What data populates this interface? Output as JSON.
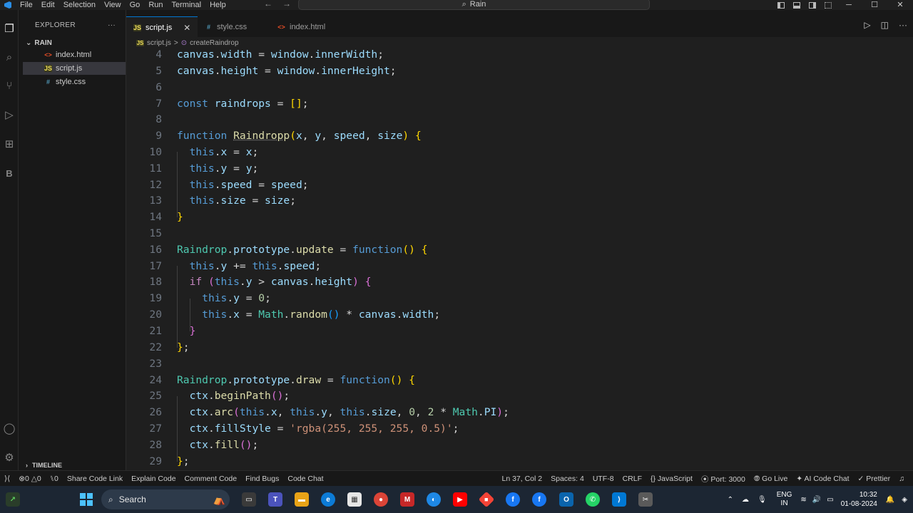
{
  "titlebar": {
    "menu": [
      "File",
      "Edit",
      "Selection",
      "View",
      "Go",
      "Run",
      "Terminal",
      "Help"
    ],
    "search": "Rain",
    "back_icon": "arrow-left-icon",
    "forward_icon": "arrow-right-icon"
  },
  "sidebar": {
    "title": "EXPLORER",
    "more": "···",
    "folder": "RAIN",
    "files": [
      {
        "name": "index.html",
        "icon": "html-file-icon",
        "badge": "<>"
      },
      {
        "name": "script.js",
        "icon": "js-file-icon",
        "badge": "JS"
      },
      {
        "name": "style.css",
        "icon": "css-file-icon",
        "badge": "#"
      }
    ],
    "timeline": "TIMELINE"
  },
  "tabs": [
    {
      "label": "script.js",
      "badge": "JS",
      "active": true
    },
    {
      "label": "style.css",
      "badge": "#",
      "active": false
    },
    {
      "label": "index.html",
      "badge": "<>",
      "active": false
    }
  ],
  "breadcrumb": {
    "file": "script.js",
    "separator": ">",
    "symbol": "createRaindrop"
  },
  "editor": {
    "line_numbers": [
      "4",
      "5",
      "6",
      "7",
      "8",
      "9",
      "10",
      "11",
      "12",
      "13",
      "14",
      "15",
      "16",
      "17",
      "18",
      "19",
      "20",
      "21",
      "22",
      "23",
      "24",
      "25",
      "26",
      "27",
      "28",
      "29"
    ]
  },
  "status": {
    "errors": "0",
    "warnings": "0",
    "ports": "0",
    "share": "Share Code Link",
    "explain": "Explain Code",
    "comment": "Comment Code",
    "bugs": "Find Bugs",
    "chat": "Code Chat",
    "position": "Ln 37, Col 2",
    "spaces": "Spaces: 4",
    "encoding": "UTF-8",
    "eol": "CRLF",
    "language": "JavaScript",
    "port": "Port: 3000",
    "golive": "Go Live",
    "ai": "AI Code Chat",
    "prettier": "Prettier"
  },
  "taskbar": {
    "search": "Search",
    "lang_top": "ENG",
    "lang_bottom": "IN",
    "time": "10:32",
    "date": "01-08-2024"
  },
  "colors": {
    "accent": "#0078d4",
    "keyword": "#569cd6",
    "function": "#dcdcaa",
    "variable": "#9cdcfe",
    "string": "#ce9178",
    "number": "#b5cea8"
  }
}
